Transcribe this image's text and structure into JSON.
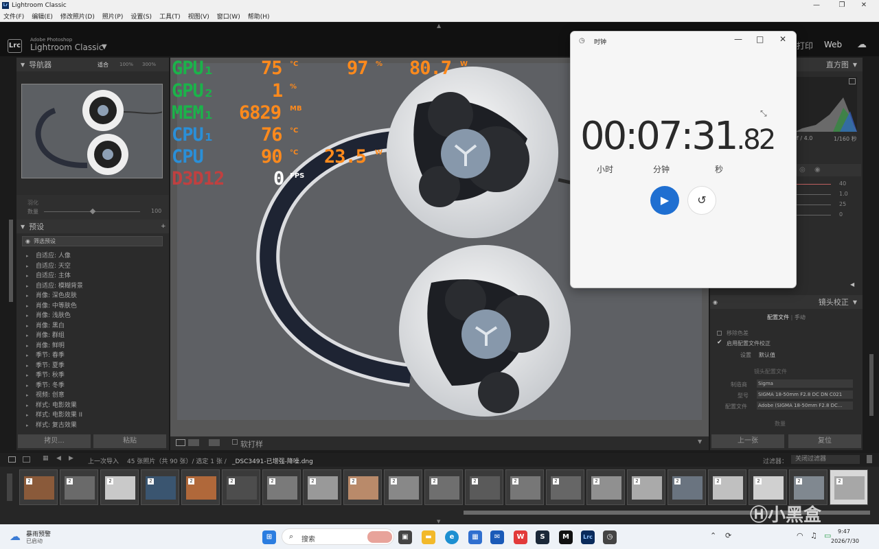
{
  "window": {
    "title": "Lightroom Classic"
  },
  "menu": [
    "文件(F)",
    "编辑(E)",
    "修改照片(D)",
    "照片(P)",
    "设置(S)",
    "工具(T)",
    "视图(V)",
    "窗口(W)",
    "帮助(H)"
  ],
  "app": {
    "brand_top": "Adobe Photoshop",
    "brand_name": "Lightroom Classic",
    "logo": "Lrc",
    "modules": [
      "打印",
      "Web"
    ]
  },
  "navigator": {
    "title": "导航器",
    "zoom": [
      "适合",
      "100%",
      "300%"
    ]
  },
  "left_misc": {
    "sliders": [
      "羽化",
      "数量"
    ],
    "amount_value": "100",
    "presets_title": "预设",
    "filter_presets": "筛选预设"
  },
  "presets": [
    "自适应: 人像",
    "自适应: 天空",
    "自适应: 主体",
    "自适应: 模糊背景",
    "肖像: 深色皮肤",
    "肖像: 中等肤色",
    "肖像: 浅肤色",
    "肖像: 黑白",
    "肖像: 群组",
    "肖像: 鲜明",
    "季节: 春季",
    "季节: 夏季",
    "季节: 秋季",
    "季节: 冬季",
    "视频: 创意",
    "样式: 电影效果",
    "样式: 电影效果 II",
    "样式: 复古效果"
  ],
  "left_buttons": [
    "拷贝...",
    "粘贴"
  ],
  "osd": [
    {
      "label": "GPU₁",
      "label_color": "#1bb34a",
      "values": [
        {
          "v": "75",
          "u": "°C"
        },
        {
          "v": "97",
          "u": "%"
        },
        {
          "v": "80.7",
          "u": "W"
        }
      ]
    },
    {
      "label": "GPU₂",
      "label_color": "#1bb34a",
      "values": [
        {
          "v": "1",
          "u": "%"
        }
      ]
    },
    {
      "label": "MEM₁",
      "label_color": "#1bb34a",
      "values": [
        {
          "v": "6829",
          "u": "MB"
        }
      ]
    },
    {
      "label": "CPU₁",
      "label_color": "#2a8fd8",
      "values": [
        {
          "v": "76",
          "u": "°C"
        }
      ]
    },
    {
      "label": "CPU",
      "label_color": "#2a8fd8",
      "values": [
        {
          "v": "90",
          "u": "°C"
        },
        {
          "v": "23.5",
          "u": "W"
        }
      ]
    },
    {
      "label": "D3D12",
      "label_color": "#c04040",
      "values": [
        {
          "v": "0",
          "u": "FPS"
        }
      ]
    }
  ],
  "clock": {
    "title": "时钟",
    "hours": "00",
    "minutes": "07",
    "seconds": "31",
    "centis": ".82",
    "labels": [
      "小时",
      "分钟",
      "秒"
    ]
  },
  "right_panel": {
    "histogram": "直方图",
    "exif": [
      "f / 4.0",
      "1/160 秒"
    ],
    "slider_values": [
      "40",
      "1.0",
      "25",
      "0"
    ],
    "lens_title": "镜头校正",
    "tabs": [
      "配置文件",
      "手动"
    ],
    "chromatic": "移除色差",
    "enable_profile": "启用配置文件校正",
    "setup_label": "设置",
    "setup_value": "默认值",
    "lens_profile": "镜头配置文件",
    "make_label": "制造商",
    "make": "Sigma",
    "model_label": "型号",
    "model": "SIGMA 18-50mm F2.8 DC DN C021",
    "profile_label": "配置文件",
    "profile": "Adobe (SIGMA 18-50mm F2.8 DC...",
    "amount": "数量",
    "prev": "上一张",
    "reset": "复位"
  },
  "toolbar": {
    "soft_proof": "软打样"
  },
  "filmbar": {
    "source": "上一次导入",
    "count": "45 张照片（共 90 张）/ 选定 1 张 /",
    "file": "_DSC3491-已增强-降噪.dng",
    "filter_label": "过滤器：",
    "filter_value": "关闭过滤器"
  },
  "taskbar": {
    "weather_title": "暴雨预警",
    "weather_sub": "已启动",
    "search": "搜索",
    "time": "9:47",
    "date": "2026/7/30"
  },
  "watermark": "小黑盒"
}
